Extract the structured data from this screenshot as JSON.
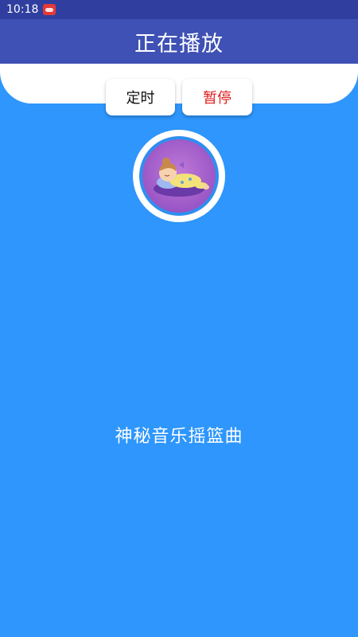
{
  "status_bar": {
    "time": "10:18",
    "notification_icon": "app-notification-icon"
  },
  "app_bar": {
    "title": "正在播放"
  },
  "controls": {
    "timer_label": "定时",
    "pause_label": "暂停"
  },
  "player": {
    "cover_icon": "sleeping-baby-image",
    "song_title": "神秘音乐摇篮曲"
  },
  "colors": {
    "status_bar": "#303f9f",
    "app_bar": "#3f51b5",
    "background": "#2e96fc",
    "pause_text": "#e01e1e"
  }
}
